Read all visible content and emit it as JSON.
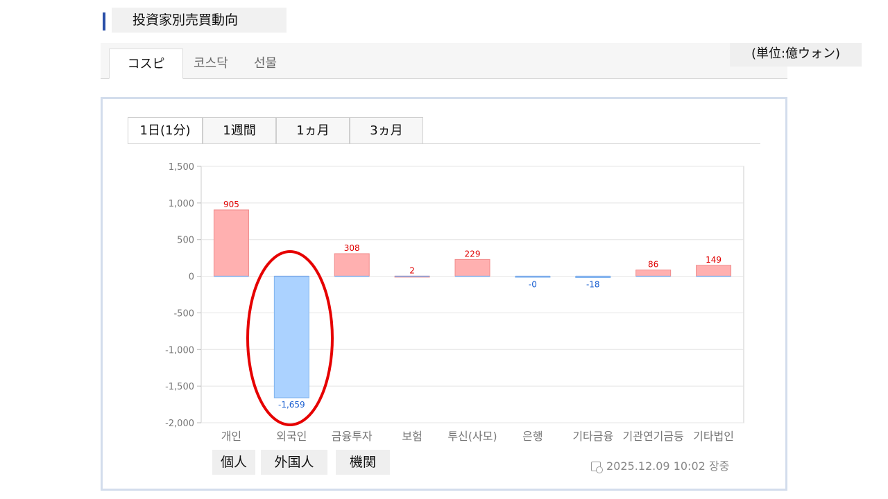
{
  "header": {
    "title": "投資家別売買動向"
  },
  "market_tabs": [
    {
      "label": "コスピ",
      "active": true
    },
    {
      "label": "코스닥",
      "active": false
    },
    {
      "label": "선물",
      "active": false
    }
  ],
  "unit_label": "(単位:億ウォン)",
  "period_tabs": [
    {
      "label": "1日(1分)",
      "active": true
    },
    {
      "label": "1週間",
      "active": false
    },
    {
      "label": "1ヵ月",
      "active": false
    },
    {
      "label": "3ヵ月",
      "active": false
    }
  ],
  "buttons": [
    {
      "label": "個人"
    },
    {
      "label": "外国人"
    },
    {
      "label": "機関"
    }
  ],
  "timestamp": "2025.12.09 10:02 장중",
  "colors": {
    "positive_fill": "#ffb0b0",
    "positive_label": "#e00000",
    "negative_fill": "#abd2ff",
    "negative_label": "#1a5fd1",
    "highlight": "#e60000",
    "accent": "#2a4fa8"
  },
  "chart_data": {
    "type": "bar",
    "categories": [
      "개인",
      "외국인",
      "금융투자",
      "보험",
      "투신(사모)",
      "은행",
      "기타금융",
      "기관연기금등",
      "기타법인"
    ],
    "values": [
      905,
      -1659,
      308,
      2,
      229,
      -0.4,
      -18,
      86,
      149
    ],
    "data_labels": [
      "905",
      "-1,659",
      "308",
      "2",
      "229",
      "-0",
      "-18",
      "86",
      "149"
    ],
    "yticks": [
      "1,500",
      "1,000",
      "500",
      "0",
      "-500",
      "-1,000",
      "-1,500",
      "-2,000"
    ],
    "ylim": [
      -2000,
      1500
    ],
    "grid": true,
    "highlighted_category": "외국인"
  }
}
